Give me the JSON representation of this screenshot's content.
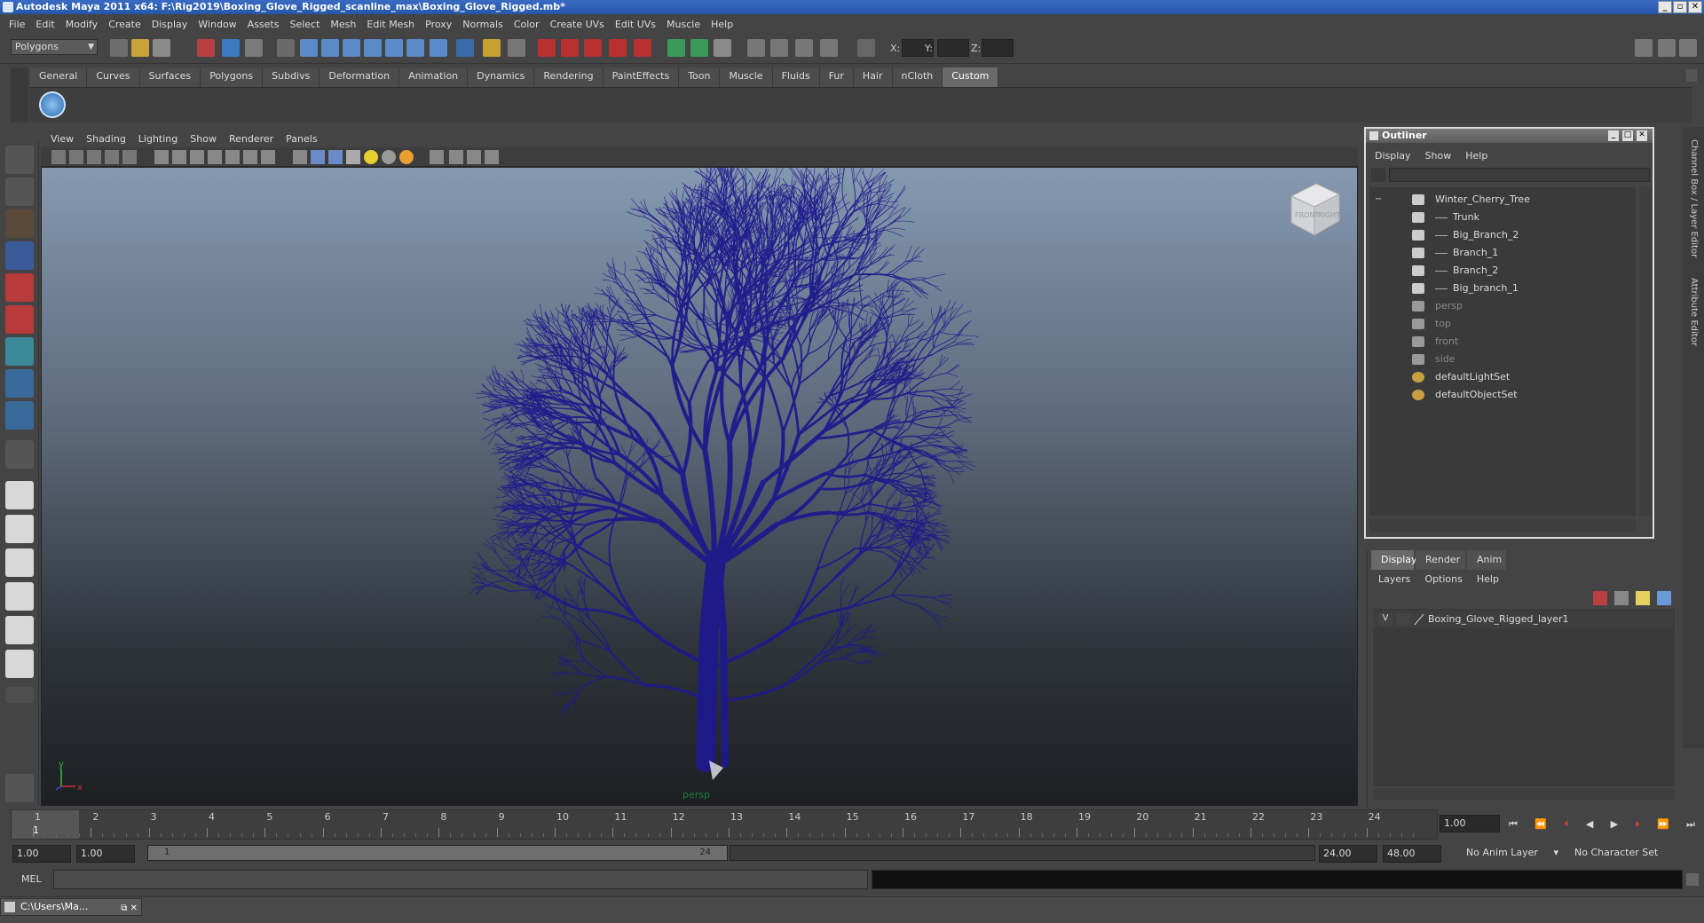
{
  "window": {
    "title": "Autodesk Maya 2011 x64: F:\\Rig2019\\Boxing_Glove_Rigged_scanline_max\\Boxing_Glove_Rigged.mb*"
  },
  "menubar": [
    "File",
    "Edit",
    "Modify",
    "Create",
    "Display",
    "Window",
    "Assets",
    "Select",
    "Mesh",
    "Edit Mesh",
    "Proxy",
    "Normals",
    "Color",
    "Create UVs",
    "Edit UVs",
    "Muscle",
    "Help"
  ],
  "statusline": {
    "mode": "Polygons",
    "x_label": "X:",
    "y_label": "Y:",
    "z_label": "Z:"
  },
  "shelf_tabs": [
    "General",
    "Curves",
    "Surfaces",
    "Polygons",
    "Subdivs",
    "Deformation",
    "Animation",
    "Dynamics",
    "Rendering",
    "PaintEffects",
    "Toon",
    "Muscle",
    "Fluids",
    "Fur",
    "Hair",
    "nCloth",
    "Custom"
  ],
  "shelf_active": "Custom",
  "viewport": {
    "menus": [
      "View",
      "Shading",
      "Lighting",
      "Show",
      "Renderer",
      "Panels"
    ],
    "camera_label": "persp",
    "viewcube_front": "FRONT",
    "viewcube_right": "RIGHT",
    "axis_y": "y",
    "axis_x": "x",
    "mesh_color": "#1d1a8c"
  },
  "outliner": {
    "title": "Outliner",
    "menus": [
      "Display",
      "Show",
      "Help"
    ],
    "items": [
      {
        "label": "Winter_Cherry_Tree",
        "depth": 0,
        "expand": "−",
        "gray": false
      },
      {
        "label": "Trunk",
        "depth": 1,
        "gray": false
      },
      {
        "label": "Big_Branch_2",
        "depth": 1,
        "gray": false
      },
      {
        "label": "Branch_1",
        "depth": 1,
        "gray": false
      },
      {
        "label": "Branch_2",
        "depth": 1,
        "gray": false
      },
      {
        "label": "Big_branch_1",
        "depth": 1,
        "gray": false
      },
      {
        "label": "persp",
        "depth": 0,
        "gray": true
      },
      {
        "label": "top",
        "depth": 0,
        "gray": true
      },
      {
        "label": "front",
        "depth": 0,
        "gray": true
      },
      {
        "label": "side",
        "depth": 0,
        "gray": true
      },
      {
        "label": "defaultLightSet",
        "depth": 0,
        "gray": false
      },
      {
        "label": "defaultObjectSet",
        "depth": 0,
        "gray": false
      }
    ]
  },
  "layer_editor": {
    "tabs": [
      "Display",
      "Render",
      "Anim"
    ],
    "active_tab": "Display",
    "menus": [
      "Layers",
      "Options",
      "Help"
    ],
    "layer": {
      "visible": "V",
      "name": "Boxing_Glove_Rigged_layer1"
    }
  },
  "side_tabs": [
    "Channel Box / Layer Editor",
    "Attribute Editor"
  ],
  "timeslider": {
    "ticks": [
      "1",
      "2",
      "3",
      "4",
      "5",
      "6",
      "7",
      "8",
      "9",
      "10",
      "11",
      "12",
      "13",
      "14",
      "15",
      "16",
      "17",
      "18",
      "19",
      "20",
      "21",
      "22",
      "23",
      "24"
    ],
    "current_frame": "1.00",
    "current_marker": "1"
  },
  "range": {
    "start": "1.00",
    "playback_start": "1.00",
    "slider_start": "1",
    "slider_end": "24",
    "playback_end": "24.00",
    "end": "48.00",
    "anim_layer": "No Anim Layer",
    "char_set": "No Character Set"
  },
  "cmdline": {
    "label": "MEL"
  },
  "taskbar": {
    "label": "C:\\Users\\Ma..."
  }
}
